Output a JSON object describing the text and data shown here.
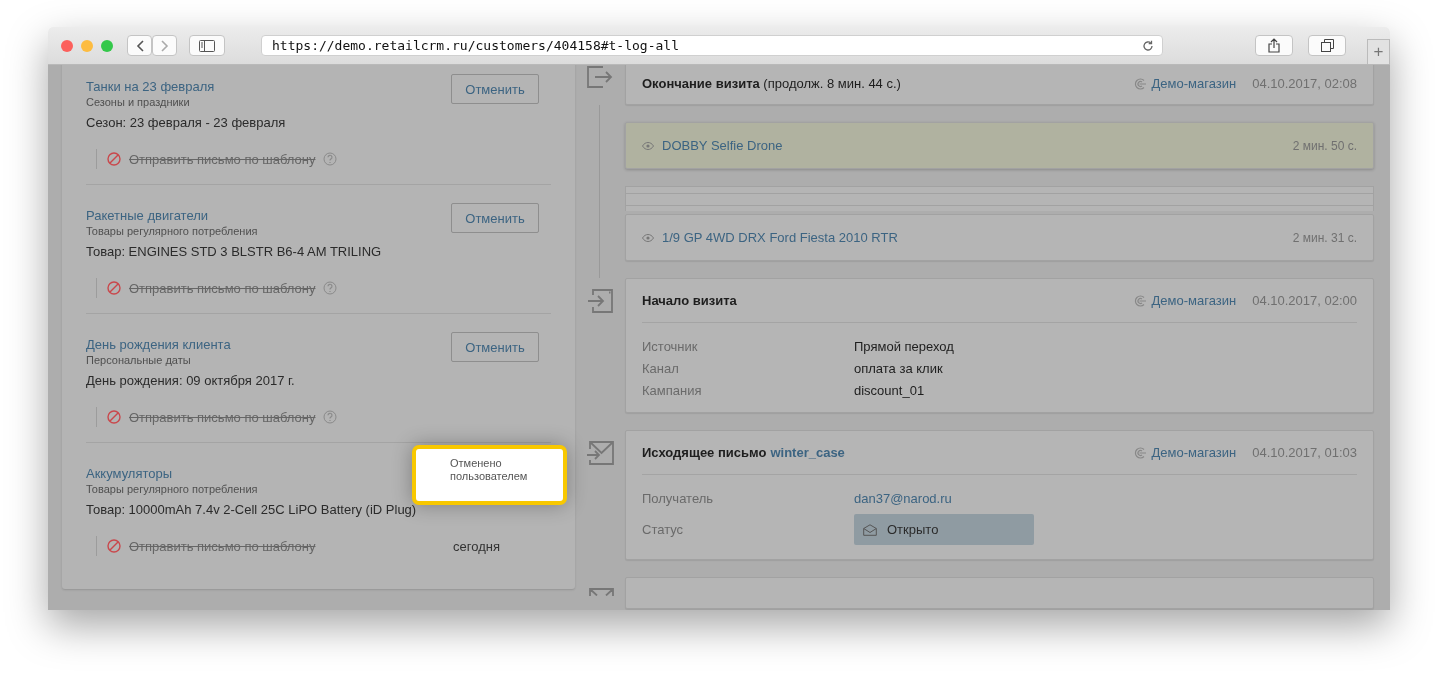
{
  "browser": {
    "url": "https://demo.retailcrm.ru/customers/404158#t-log-all",
    "new_tab": "+"
  },
  "left_panel": {
    "items": [
      {
        "kind": "active",
        "title": "Танки на 23 февраля",
        "category": "Сезоны и праздники",
        "detail": "Сезон: 23 февраля - 23 февраля",
        "action": "Отправить письмо по шаблону",
        "help": true,
        "cancel_label": "Отменить"
      },
      {
        "kind": "active",
        "title": "Ракетные двигатели",
        "category": "Товары регулярного потребления",
        "detail": "Товар: ENGINES STD 3 BLSTR B6-4 AM TRILING",
        "action": "Отправить письмо по шаблону",
        "help": true,
        "cancel_label": "Отменить"
      },
      {
        "kind": "active",
        "title": "День рождения клиента",
        "category": "Персональные даты",
        "detail": "День рождения: 09 октября 2017 г.",
        "action": "Отправить письмо по шаблону",
        "help": true,
        "cancel_label": "Отменить"
      },
      {
        "kind": "cancelled",
        "title": "Аккумуляторы",
        "category": "Товары регулярного потребления",
        "detail": "Товар: 10000mAh 7.4v 2-Cell 25C LiPO Battery (iD Plug)",
        "action": "Отправить письмо по шаблону",
        "help": false,
        "tooltip": "Отменено пользователем",
        "date": "сегодня"
      }
    ]
  },
  "timeline": [
    {
      "kind": "visit_end",
      "title": "Окончание визита",
      "note": "(продолж. 8 мин. 44 с.)",
      "shop": "Демо-магазин",
      "time": "04.10.2017, 02:08"
    },
    {
      "kind": "product_view",
      "name": "DOBBY Selfie Drone",
      "duration": "2 мин. 50 с.",
      "highlighted": true
    },
    {
      "kind": "collapsed"
    },
    {
      "kind": "product_view",
      "name": "1/9 GP 4WD DRX Ford Fiesta 2010 RTR",
      "duration": "2 мин. 31 с.",
      "highlighted": false
    },
    {
      "kind": "visit_start",
      "title": "Начало визита",
      "shop": "Демо-магазин",
      "time": "04.10.2017, 02:00",
      "fields": [
        {
          "label": "Источник",
          "value": "Прямой переход"
        },
        {
          "label": "Канал",
          "value": "оплата за клик"
        },
        {
          "label": "Кампания",
          "value": "discount_01"
        }
      ]
    },
    {
      "kind": "email_out",
      "title": "Исходящее письмо",
      "template": "winter_case",
      "shop": "Демо-магазин",
      "time": "04.10.2017, 01:03",
      "recipient_label": "Получатель",
      "recipient": "dan37@narod.ru",
      "status_label": "Статус",
      "status": "Открыто"
    },
    {
      "kind": "email_cut"
    }
  ]
}
